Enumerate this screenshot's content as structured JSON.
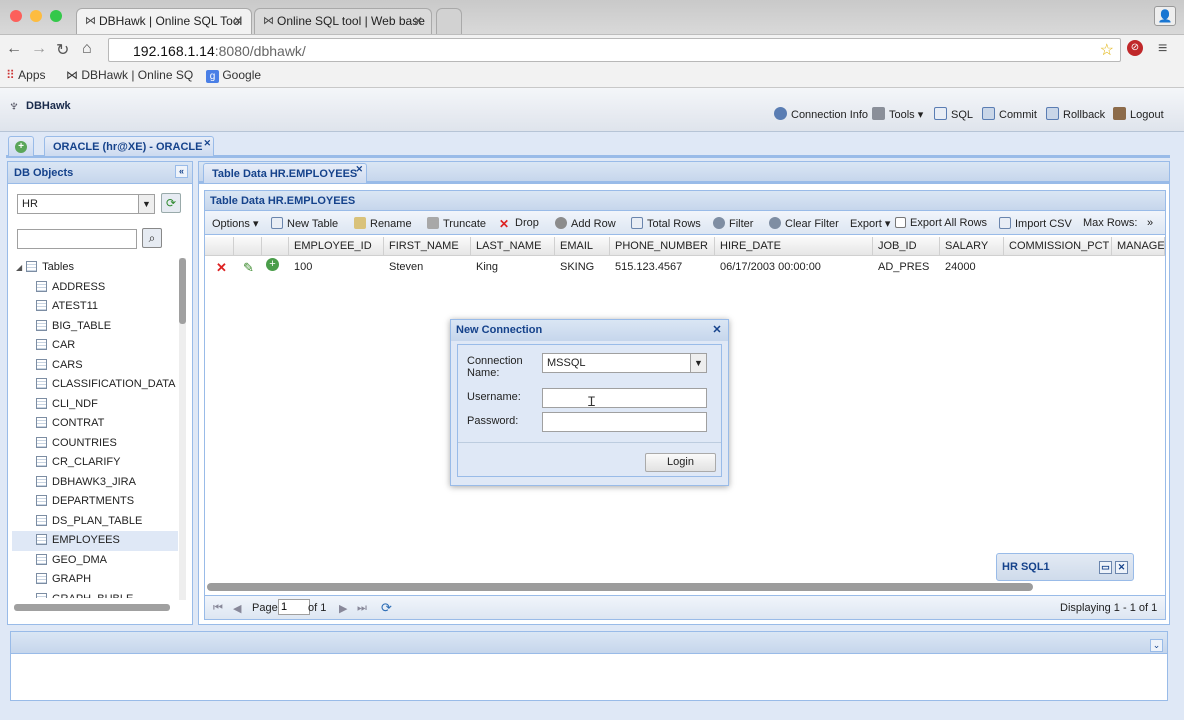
{
  "browser": {
    "tabs": [
      {
        "title": "DBHawk | Online SQL Tool"
      },
      {
        "title": "Online SQL tool | Web base"
      }
    ],
    "url_domain": "192.168.1.14",
    "url_path": ":8080/dbhawk/",
    "bookmarks": [
      "Apps",
      "DBHawk | Online SQ",
      "Google"
    ]
  },
  "app": {
    "logo": "DBHawk",
    "toolbar": [
      "Connection Info",
      "Tools ▾",
      "SQL",
      "Commit",
      "Rollback",
      "Logout"
    ],
    "connection_tab": "ORACLE (hr@XE) - ORACLE"
  },
  "db_objects": {
    "title": "DB Objects",
    "schema": "HR",
    "search_placeholder": "",
    "root": "Tables",
    "tables": [
      "ADDRESS",
      "ATEST11",
      "BIG_TABLE",
      "CAR",
      "CARS",
      "CLASSIFICATION_DATA",
      "CLI_NDF",
      "CONTRAT",
      "COUNTRIES",
      "CR_CLARIFY",
      "DBHAWK3_JIRA",
      "DEPARTMENTS",
      "DS_PLAN_TABLE",
      "EMPLOYEES",
      "GEO_DMA",
      "GRAPH",
      "GRAPH_BUBLE"
    ],
    "selected": "EMPLOYEES"
  },
  "table_panel": {
    "tab_title": "Table Data HR.EMPLOYEES",
    "panel_title": "Table Data HR.EMPLOYEES",
    "toolbar": [
      "Options ▾",
      "New Table",
      "Rename",
      "Truncate",
      "Drop",
      "Add Row",
      "Total Rows",
      "Filter",
      "Clear Filter",
      "Export ▾",
      "Export All Rows",
      "Import CSV",
      "Max Rows:",
      "»"
    ],
    "columns": [
      "EMPLOYEE_ID",
      "FIRST_NAME",
      "LAST_NAME",
      "EMAIL",
      "PHONE_NUMBER",
      "HIRE_DATE",
      "JOB_ID",
      "SALARY",
      "COMMISSION_PCT",
      "MANAGE"
    ],
    "row": [
      "100",
      "Steven",
      "King",
      "SKING",
      "515.123.4567",
      "06/17/2003 00:00:00",
      "AD_PRES",
      "24000",
      "",
      ""
    ],
    "pager": {
      "page_label": "Page",
      "page_value": "1",
      "of_label": "of 1",
      "display": "Displaying 1 - 1 of 1"
    }
  },
  "bottom": {
    "window_title": "HR SQL1"
  },
  "dialog": {
    "title": "New Connection",
    "conn_label_1": "Connection",
    "conn_label_2": "Name:",
    "conn_value": "MSSQL",
    "username_label": "Username:",
    "username_value": "",
    "password_label": "Password:",
    "password_value": "",
    "login_button": "Login"
  },
  "colors": {
    "accent": "#15428b",
    "border": "#99bbe8",
    "panel_bg": "#dfe8f6"
  },
  "icons": [
    "back-icon",
    "forward-icon",
    "reload-icon",
    "home-icon",
    "star-icon",
    "menu-icon",
    "user-icon",
    "info-icon",
    "wrench-icon",
    "sql-icon",
    "commit-icon",
    "rollback-icon",
    "logout-icon",
    "delete-icon",
    "edit-icon",
    "add-icon",
    "search-icon",
    "refresh-icon"
  ]
}
